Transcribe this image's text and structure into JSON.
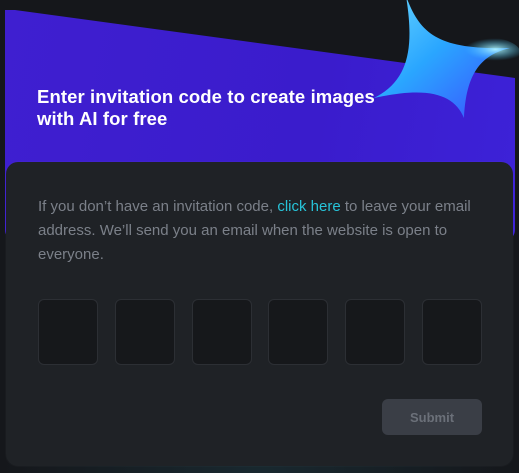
{
  "header": {
    "title": "Enter invitation code to create images with AI for free"
  },
  "description": {
    "text_before": "If you don’t have an invitation code, ",
    "link_label": "click here",
    "text_after": " to leave your email address. We’ll send you an email when the website is open to everyone."
  },
  "code_inputs": [
    "",
    "",
    "",
    "",
    "",
    ""
  ],
  "submit": {
    "label": "Submit"
  },
  "colors": {
    "banner": "#3a1ccc",
    "card": "#1f2226",
    "link": "#27c3d8",
    "button": "#3a3e46"
  },
  "icons": {
    "decoration": "sparkle-star-icon"
  }
}
